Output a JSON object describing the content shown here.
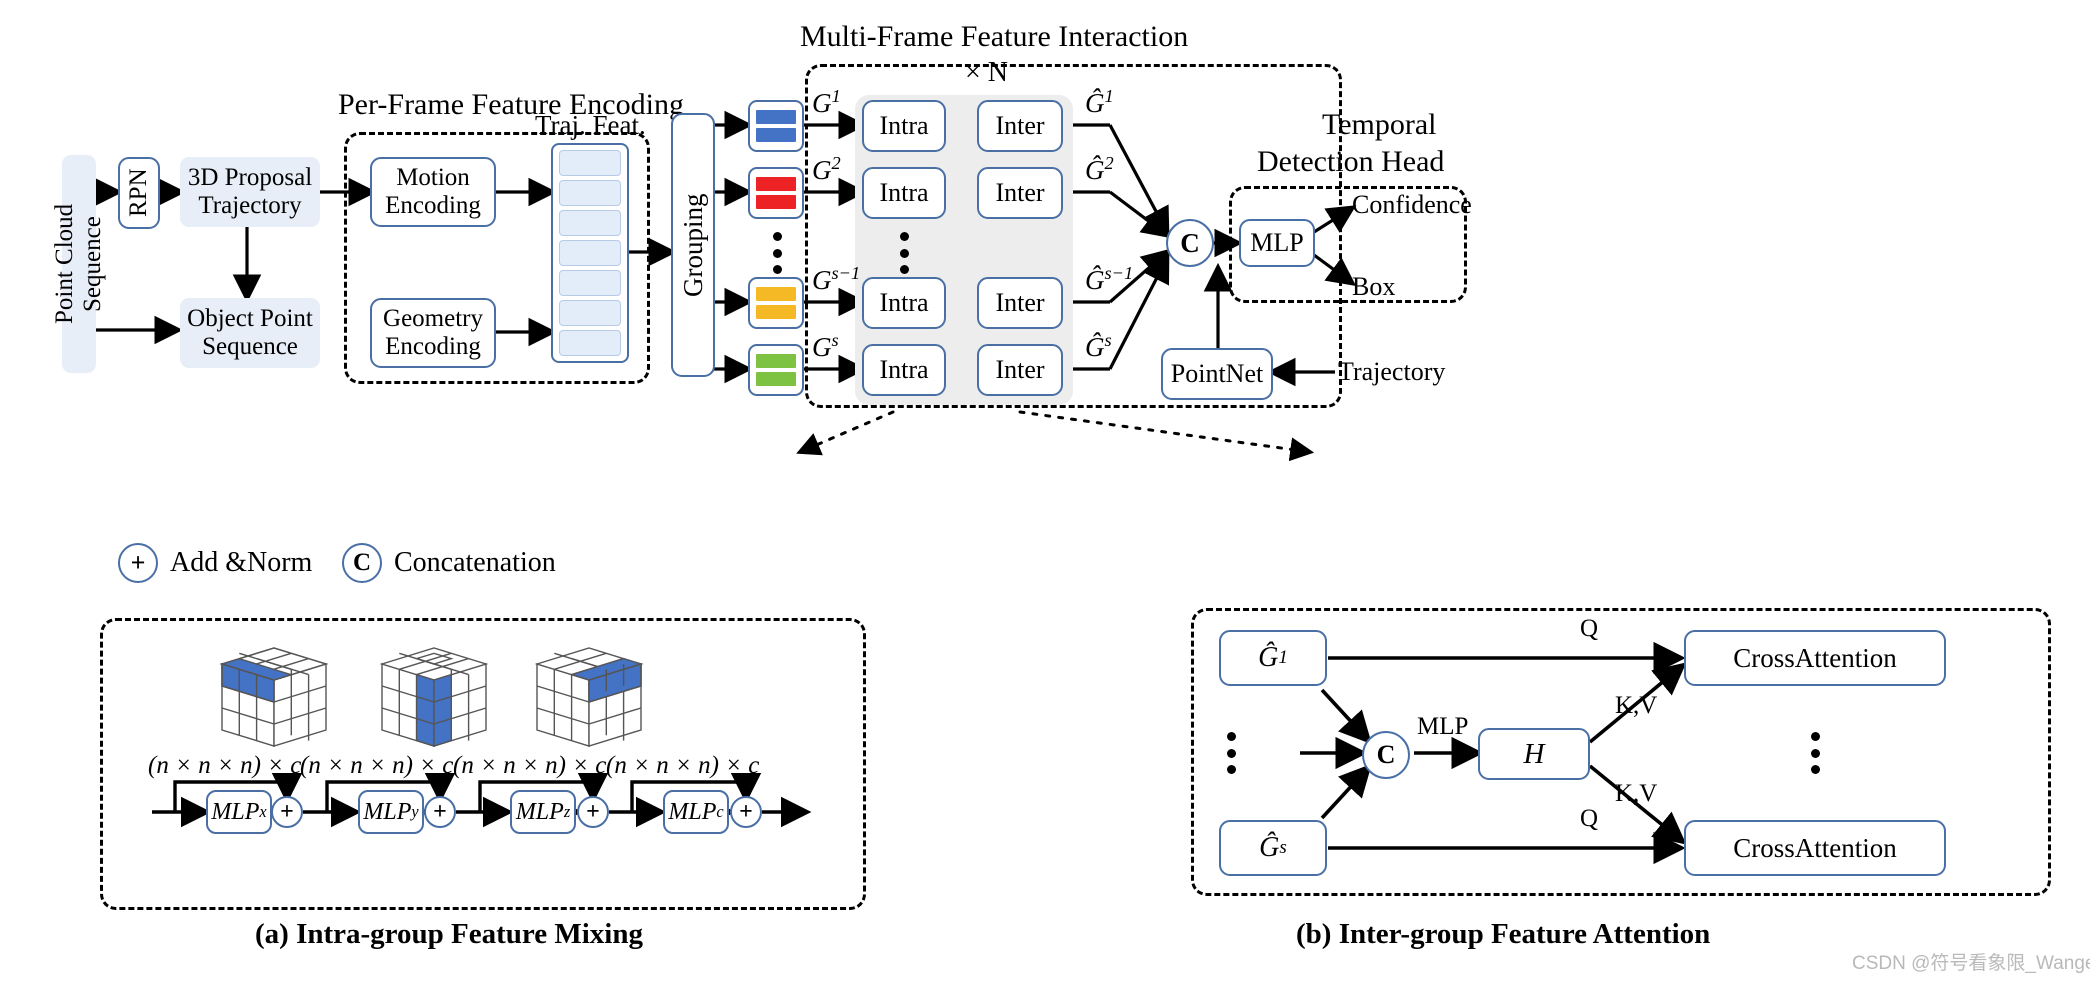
{
  "titles": {
    "per_frame": "Per-Frame Feature Encoding",
    "multi_frame": "Multi-Frame Feature Interaction",
    "temporal_head_l1": "Temporal",
    "temporal_head_l2": "Detection Head",
    "repeat": "× N",
    "traj_feat": "Traj. Feat."
  },
  "pipeline": {
    "point_cloud_sequence": "Point Cloud Sequence",
    "rpn": "RPN",
    "proposal_l1": "3D Proposal",
    "proposal_l2": "Trajectory",
    "object_point_l1": "Object Point",
    "object_point_l2": "Sequence",
    "motion_l1": "Motion",
    "motion_l2": "Encoding",
    "geometry_l1": "Geometry",
    "geometry_l2": "Encoding",
    "grouping": "Grouping",
    "pointnet": "PointNet",
    "trajectory": "Trajectory",
    "mlp": "MLP",
    "confidence": "Confidence",
    "box": "Box",
    "concat_glyph": "C"
  },
  "groups": [
    {
      "label": "G",
      "sup": "1",
      "out_sup": "1",
      "color": "#4472c4",
      "name": "group-1"
    },
    {
      "label": "G",
      "sup": "2",
      "out_sup": "2",
      "color": "#ed2224",
      "name": "group-2"
    },
    {
      "label": "G",
      "sup": "s−1",
      "out_sup": "s−1",
      "color": "#f5b925",
      "name": "group-s-1"
    },
    {
      "label": "G",
      "sup": "s",
      "out_sup": "s",
      "color": "#7dc242",
      "name": "group-s"
    }
  ],
  "blocks": {
    "intra": "Intra",
    "inter": "Inter"
  },
  "legend": [
    {
      "glyph": "+",
      "label": "Add &Norm",
      "name": "legend-add-norm"
    },
    {
      "glyph": "C",
      "label": "Concatenation",
      "name": "legend-concatenation"
    }
  ],
  "panel_a": {
    "caption": "(a) Intra-group Feature Mixing",
    "dim_label": "(n × n × n) × c",
    "stages": [
      {
        "mlp": "MLP",
        "sup": "x",
        "cube": "row-top-left",
        "dim": "(n × n × n) × c"
      },
      {
        "mlp": "MLP",
        "sup": "y",
        "cube": "column-middle",
        "dim": "(n × n × n) × c"
      },
      {
        "mlp": "MLP",
        "sup": "z",
        "cube": "row-right-face",
        "dim": "(n × n × n) × c"
      },
      {
        "mlp": "MLP",
        "sup": "c",
        "cube": "channel",
        "dim": "(n × n × n) × c"
      }
    ],
    "plus_glyph": "+"
  },
  "panel_b": {
    "caption": "(b) Inter-group Feature Attention",
    "g_first": {
      "label": "G",
      "sup": "1"
    },
    "g_last": {
      "label": "G",
      "sup": "s"
    },
    "concat_glyph": "C",
    "mlp_label": "MLP",
    "h_label": "H",
    "q_label": "Q",
    "kv_label": "K,V",
    "cross_attention": "CrossAttention"
  },
  "watermark": "CSDN @符号看象限_Wangerer",
  "colors": {
    "stroke_blue": "#4a6fa5",
    "fill_light": "#e8eef8",
    "gray_band": "#ededed",
    "cube_blue": "#4472c4"
  }
}
